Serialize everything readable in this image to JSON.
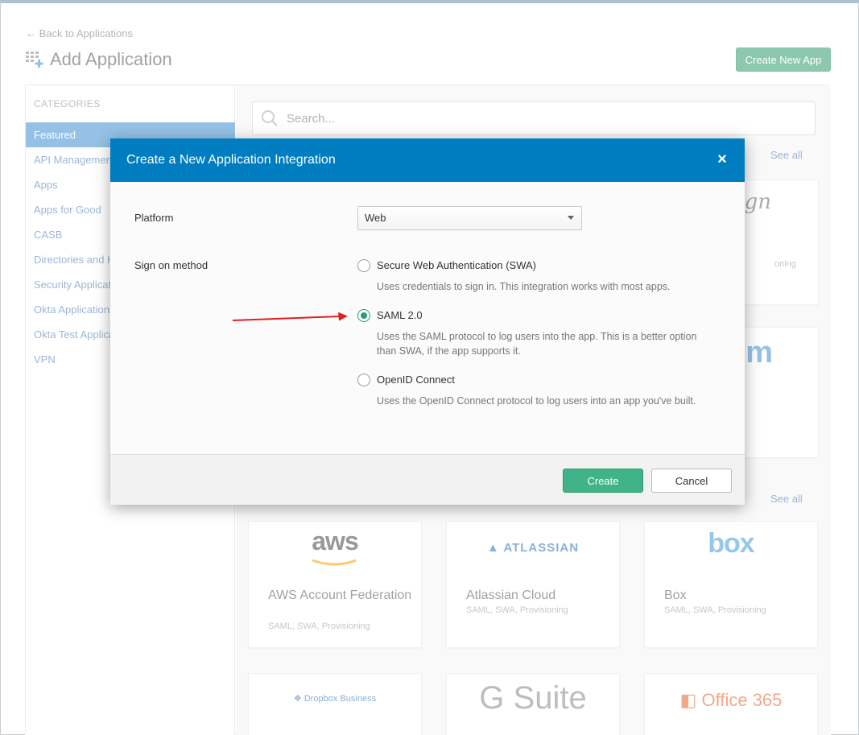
{
  "page": {
    "back_link": "← Back to Applications",
    "title": "Add Application",
    "create_new_app": "Create New App"
  },
  "sidebar": {
    "header": "CATEGORIES",
    "items": [
      {
        "label": "Featured",
        "active": true
      },
      {
        "label": "API Management",
        "active": false
      },
      {
        "label": "Apps",
        "active": false
      },
      {
        "label": "Apps for Good",
        "active": false
      },
      {
        "label": "CASB",
        "active": false
      },
      {
        "label": "Directories and HR",
        "active": false
      },
      {
        "label": "Security Applications",
        "active": false
      },
      {
        "label": "Okta Applications",
        "active": false
      },
      {
        "label": "Okta Test Applications",
        "active": false
      },
      {
        "label": "VPN",
        "active": false
      }
    ]
  },
  "main": {
    "search_placeholder": "Search...",
    "see_all_1": "See all",
    "see_all_2": "See all",
    "partial_logo_1": "ign",
    "partial_sub_1": "oning",
    "partial_logo_2": "m",
    "cards": [
      {
        "logo": "aws",
        "title": "AWS Account Federation",
        "sub": "SAML, SWA, Provisioning"
      },
      {
        "logo": "ATLASSIAN",
        "title": "Atlassian Cloud",
        "sub": "SAML, SWA, Provisioning"
      },
      {
        "logo": "box",
        "title": "Box",
        "sub": "SAML, SWA, Provisioning"
      },
      {
        "logo": "Dropbox Business",
        "title": "",
        "sub": ""
      },
      {
        "logo": "G Suite",
        "title": "",
        "sub": ""
      },
      {
        "logo": "Office 365",
        "title": "",
        "sub": ""
      }
    ]
  },
  "modal": {
    "title": "Create a New Application Integration",
    "platform_label": "Platform",
    "platform_value": "Web",
    "sign_on_label": "Sign on method",
    "options": [
      {
        "label": "Secure Web Authentication (SWA)",
        "desc": "Uses credentials to sign in. This integration works with most apps.",
        "checked": false
      },
      {
        "label": "SAML 2.0",
        "desc": "Uses the SAML protocol to log users into the app. This is a better option than SWA, if the app supports it.",
        "checked": true
      },
      {
        "label": "OpenID Connect",
        "desc": "Uses the OpenID Connect protocol to log users into an app you've built.",
        "checked": false
      }
    ],
    "create_label": "Create",
    "cancel_label": "Cancel"
  },
  "colors": {
    "header_blue": "#007dc1",
    "accent_green": "#2e9b6e",
    "sidebar_active": "#3d8fd0",
    "annotation_red": "#e02020"
  }
}
